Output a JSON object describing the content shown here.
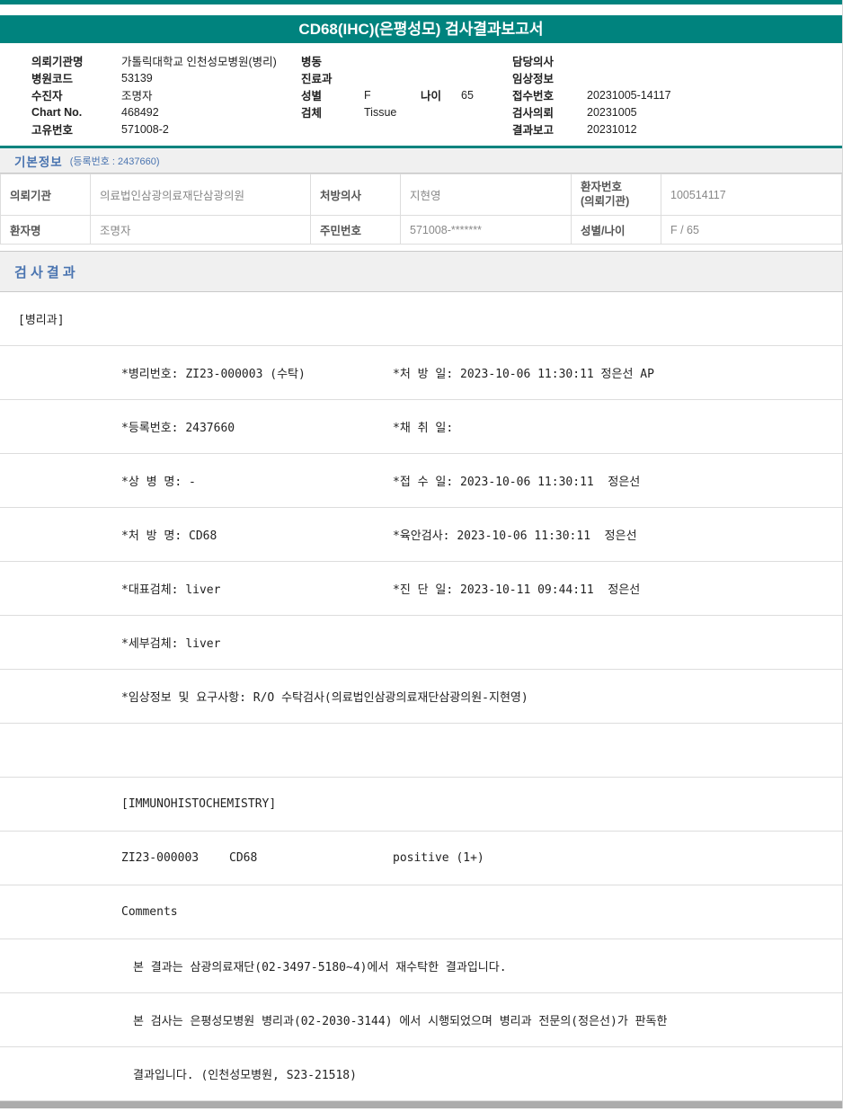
{
  "report": {
    "title": "CD68(IHC)(은평성모) 검사결과보고서"
  },
  "patient_header": {
    "col1": [
      {
        "label": "의뢰기관명",
        "value": "가톨릭대학교 인천성모병원(병리)"
      },
      {
        "label": "병원코드",
        "value": "53139"
      },
      {
        "label": "수진자",
        "value": "조명자"
      },
      {
        "label": "Chart No.",
        "value": "468492"
      },
      {
        "label": "고유번호",
        "value": "571008-2"
      }
    ],
    "col2": [
      {
        "label": "병동",
        "value": ""
      },
      {
        "label": "진료과",
        "value": ""
      },
      {
        "label": "성별",
        "value": "F",
        "label2": "나이",
        "value2": "65"
      },
      {
        "label": "검체",
        "value": "Tissue"
      }
    ],
    "col3": [
      {
        "label": "담당의사",
        "value": ""
      },
      {
        "label": "임상정보",
        "value": ""
      },
      {
        "label": "접수번호",
        "value": "20231005-14117"
      },
      {
        "label": "검사의뢰",
        "value": "20231005"
      },
      {
        "label": "결과보고",
        "value": "20231012"
      }
    ]
  },
  "basic_info": {
    "title": "기본정보",
    "subtitle": "(등록번호 : 2437660)",
    "row1": {
      "c1_label": "의뢰기관",
      "c1_value": "의료법인삼광의료재단삼광의원",
      "c2_label": "처방의사",
      "c2_value": "지현영",
      "c3_label": "환자번호\n(의뢰기관)",
      "c3_value": "100514117"
    },
    "row2": {
      "c1_label": "환자명",
      "c1_value": "조명자",
      "c2_label": "주민번호",
      "c2_value": "571008-*******",
      "c3_label": "성별/나이",
      "c3_value": "F / 65"
    }
  },
  "results": {
    "title": "검 사 결 과",
    "department": "[병리과]",
    "fields": [
      {
        "l": "*병리번호: ZI23-000003 (수탁)",
        "r": "*처 방 일: 2023-10-06 11:30:11 정은선 AP"
      },
      {
        "l": "*등록번호: 2437660",
        "r": "*채 취 일:"
      },
      {
        "l": "*상 병 명: -",
        "r": "*접 수 일: 2023-10-06 11:30:11  정은선"
      },
      {
        "l": "*처 방 명: CD68",
        "r": "*육안검사: 2023-10-06 11:30:11  정은선"
      },
      {
        "l": "*대표검체: liver",
        "r": "*진 단 일: 2023-10-11 09:44:11  정은선"
      },
      {
        "l": "*세부검체: liver",
        "r": ""
      },
      {
        "l": "*임상정보 및 요구사항: R/O 수탁검사(의료법인삼광의료재단삼광의원-지현영)",
        "r": ""
      }
    ],
    "ihc_header": "[IMMUNOHISTOCHEMISTRY]",
    "ihc_row": {
      "code": "ZI23-000003",
      "test": "CD68",
      "result": "positive (1+)"
    },
    "comments_label": "Comments",
    "comments": [
      "본 결과는 삼광의료재단(02-3497-5180~4)에서 재수탁한 결과입니다.",
      "본 검사는 은평성모병원 병리과(02-2030-3144) 에서 시행되었으며 병리과 전문의(정은선)가 판독한",
      "결과입니다. (인천성모병원, S23-21518)"
    ]
  }
}
